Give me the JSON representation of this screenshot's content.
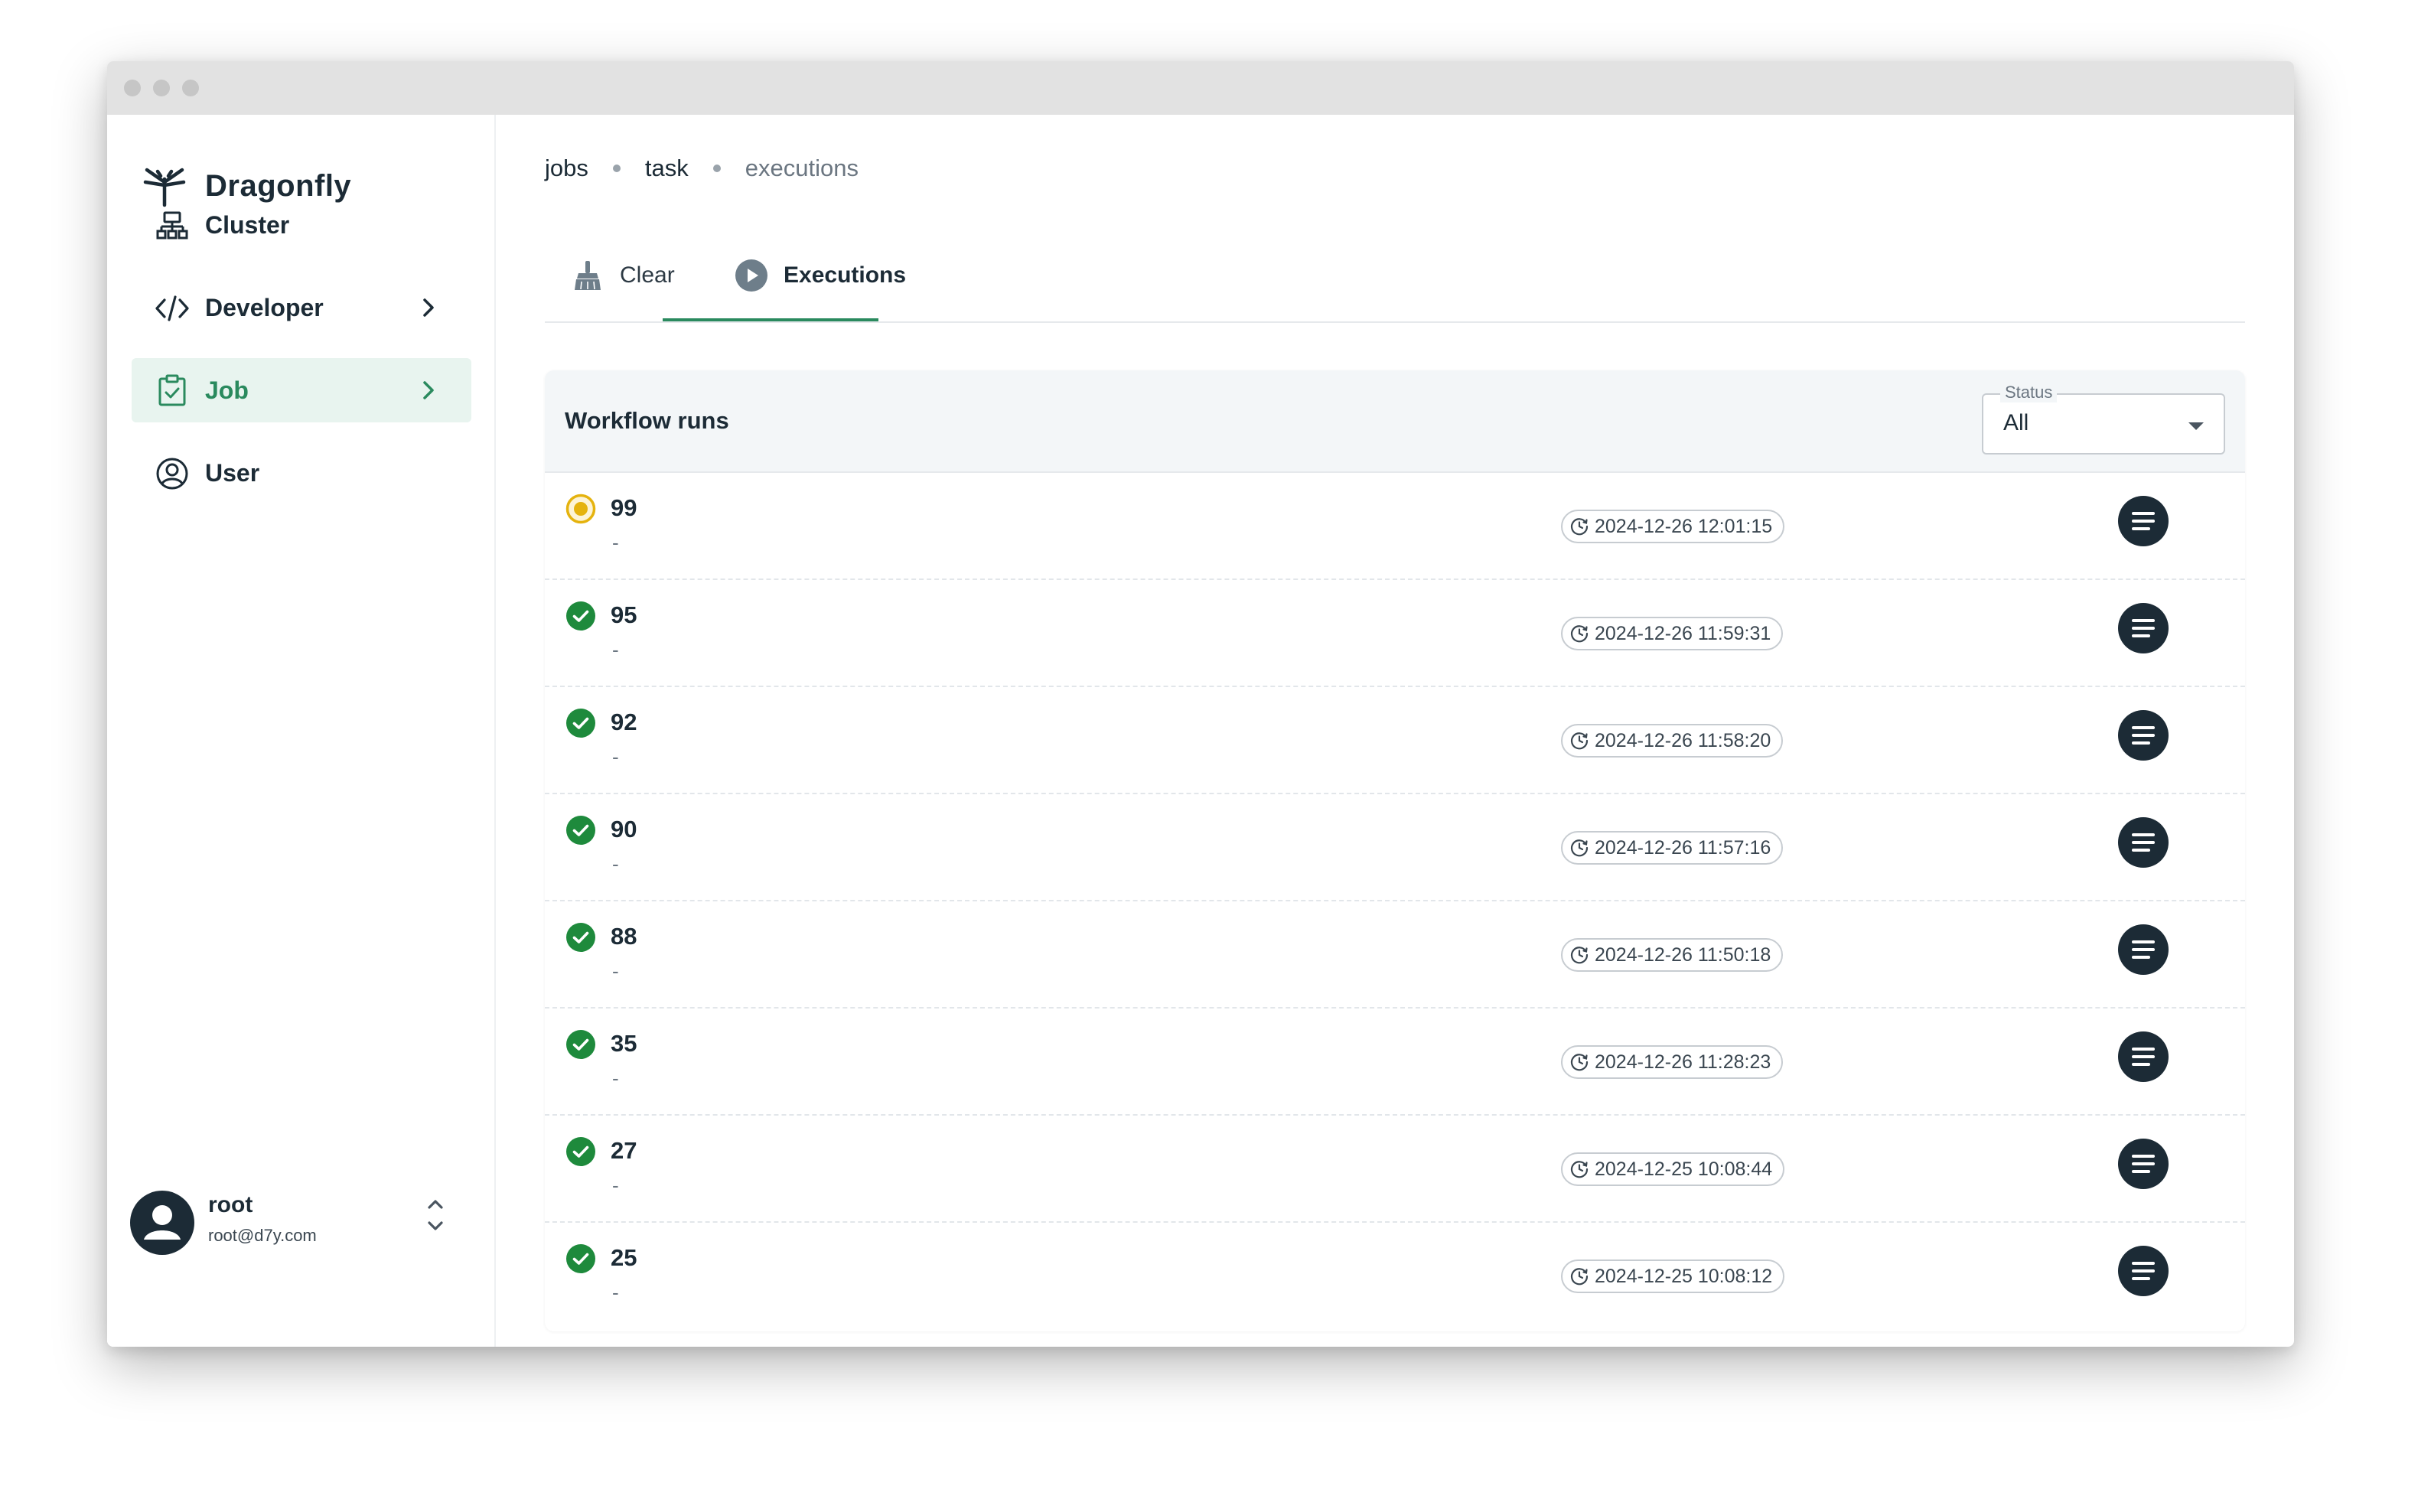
{
  "app": {
    "name": "Dragonfly"
  },
  "sidebar": {
    "items": [
      {
        "label": "Cluster",
        "icon": "cluster-icon",
        "active": false,
        "has_children": false
      },
      {
        "label": "Developer",
        "icon": "code-icon",
        "active": false,
        "has_children": true
      },
      {
        "label": "Job",
        "icon": "clipboard-check-icon",
        "active": true,
        "has_children": true
      },
      {
        "label": "User",
        "icon": "user-circle-icon",
        "active": false,
        "has_children": false
      }
    ],
    "user": {
      "name": "root",
      "email": "root@d7y.com"
    }
  },
  "breadcrumb": [
    "jobs",
    "task",
    "executions"
  ],
  "tabs": [
    {
      "label": "Clear",
      "icon": "broom-icon",
      "active": false
    },
    {
      "label": "Executions",
      "icon": "play-circle-icon",
      "active": true
    }
  ],
  "workflow": {
    "title": "Workflow runs",
    "status_filter": {
      "label": "Status",
      "value": "All"
    },
    "rows": [
      {
        "id": "99",
        "sub": "-",
        "status": "pending",
        "timestamp": "2024-12-26 12:01:15"
      },
      {
        "id": "95",
        "sub": "-",
        "status": "success",
        "timestamp": "2024-12-26 11:59:31"
      },
      {
        "id": "92",
        "sub": "-",
        "status": "success",
        "timestamp": "2024-12-26 11:58:20"
      },
      {
        "id": "90",
        "sub": "-",
        "status": "success",
        "timestamp": "2024-12-26 11:57:16"
      },
      {
        "id": "88",
        "sub": "-",
        "status": "success",
        "timestamp": "2024-12-26 11:50:18"
      },
      {
        "id": "35",
        "sub": "-",
        "status": "success",
        "timestamp": "2024-12-26 11:28:23"
      },
      {
        "id": "27",
        "sub": "-",
        "status": "success",
        "timestamp": "2024-12-25 10:08:44"
      },
      {
        "id": "25",
        "sub": "-",
        "status": "success",
        "timestamp": "2024-12-25 10:08:12"
      }
    ]
  },
  "colors": {
    "accent": "#2a8a5e",
    "active_bg": "#e8f4ef",
    "success": "#1e8a3c",
    "pending": "#e5b30e",
    "dark": "#1c2b36"
  }
}
